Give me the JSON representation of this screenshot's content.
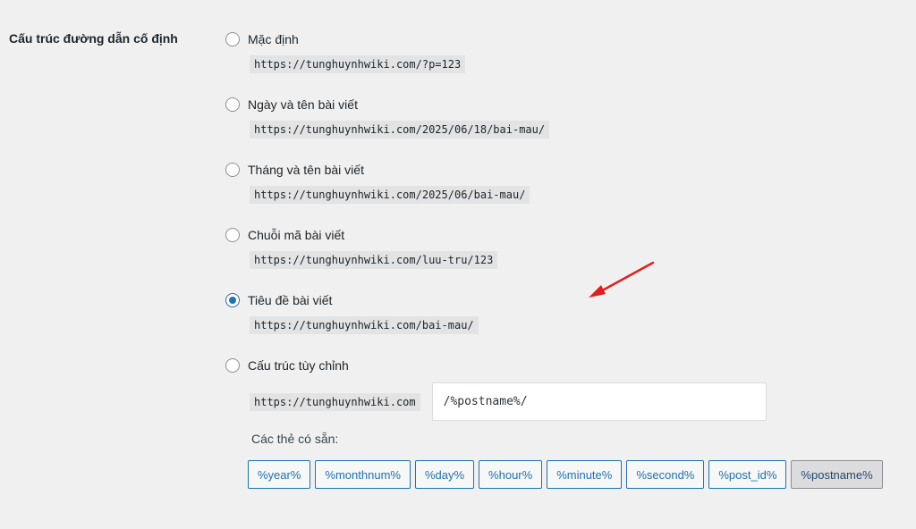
{
  "section": {
    "label": "Cấu trúc đường dẫn cố định"
  },
  "options": [
    {
      "label": "Mặc định",
      "example": "https://tunghuynhwiki.com/?p=123",
      "checked": false
    },
    {
      "label": "Ngày và tên bài viết",
      "example": "https://tunghuynhwiki.com/2025/06/18/bai-mau/",
      "checked": false
    },
    {
      "label": "Tháng và tên bài viết",
      "example": "https://tunghuynhwiki.com/2025/06/bai-mau/",
      "checked": false
    },
    {
      "label": "Chuỗi mã bài viết",
      "example": "https://tunghuynhwiki.com/luu-tru/123",
      "checked": false
    },
    {
      "label": "Tiêu đề bài viết",
      "example": "https://tunghuynhwiki.com/bai-mau/",
      "checked": true
    }
  ],
  "custom": {
    "label": "Cấu trúc tùy chỉnh",
    "checked": false,
    "base_url": "https://tunghuynhwiki.com",
    "structure_value": "/%postname%/"
  },
  "tags": {
    "label": "Các thẻ có sẵn:",
    "items": [
      "%year%",
      "%monthnum%",
      "%day%",
      "%hour%",
      "%minute%",
      "%second%",
      "%post_id%",
      "%postname%"
    ],
    "active": "%postname%"
  },
  "colors": {
    "accent": "#2271b1",
    "annotation_arrow": "#e02020",
    "background": "#f0f0f1",
    "code_background": "#e2e3e5"
  },
  "annotation": {
    "icon": "red-arrow-icon"
  }
}
